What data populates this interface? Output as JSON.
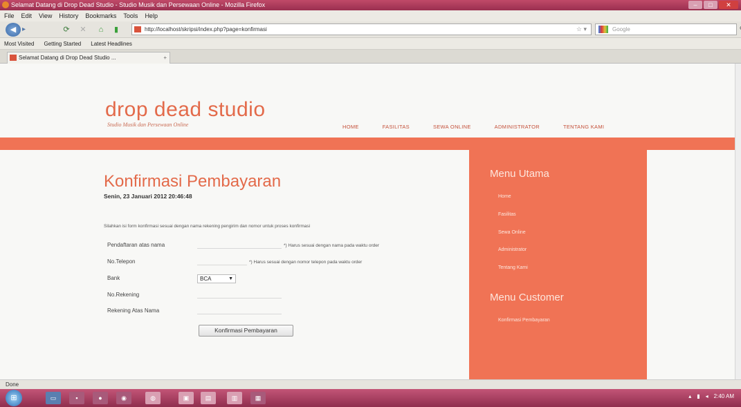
{
  "browser": {
    "title": "Selamat Datang di Drop Dead Studio - Studio Musik dan Persewaan Online - Mozilla Firefox",
    "menu": [
      "File",
      "Edit",
      "View",
      "History",
      "Bookmarks",
      "Tools",
      "Help"
    ],
    "url": "http://localhost/skripsi/index.php?page=konfirmasi",
    "search_placeholder": "Google",
    "bookmarks": [
      "Most Visited",
      "Getting Started",
      "Latest Headlines"
    ],
    "tab_title": "Selamat Datang di Drop Dead Studio ...",
    "status": "Done"
  },
  "site": {
    "logo": "drop dead studio",
    "tagline": "Studio Musik dan Persewaan Online",
    "nav": [
      "HOME",
      "FASILITAS",
      "SEWA ONLINE",
      "ADMINISTRATOR",
      "TENTANG KAMI"
    ]
  },
  "main": {
    "heading": "Konfirmasi Pembayaran",
    "date": "Senin, 23 Januari 2012 20:46:48",
    "intro": "Silahkan isi form konfirmasi sesuai dengan nama rekening pengirim dan nomor untuk proses konfirmasi",
    "form": {
      "name_label": "Pendaftaran atas nama",
      "name_note": "*) Harus sesuai dengan nama pada waktu order",
      "phone_label": "No.Telepon",
      "phone_note": "*) Harus sesuai dengan nomor telepon pada waktu order",
      "bank_label": "Bank",
      "bank_value": "BCA",
      "account_label": "No.Rekening",
      "holder_label": "Rekening Atas Nama",
      "submit_label": "Konfirmasi Pembayaran"
    }
  },
  "sidebar": {
    "menu_utama_title": "Menu Utama",
    "menu_utama": [
      "Home",
      "Fasilitas",
      "Sewa Online",
      "Administrator",
      "Tentang Kami"
    ],
    "menu_customer_title": "Menu Customer",
    "menu_customer": [
      "Konfirmasi Pembayaran"
    ]
  },
  "taskbar": {
    "time": "2:40 AM"
  }
}
